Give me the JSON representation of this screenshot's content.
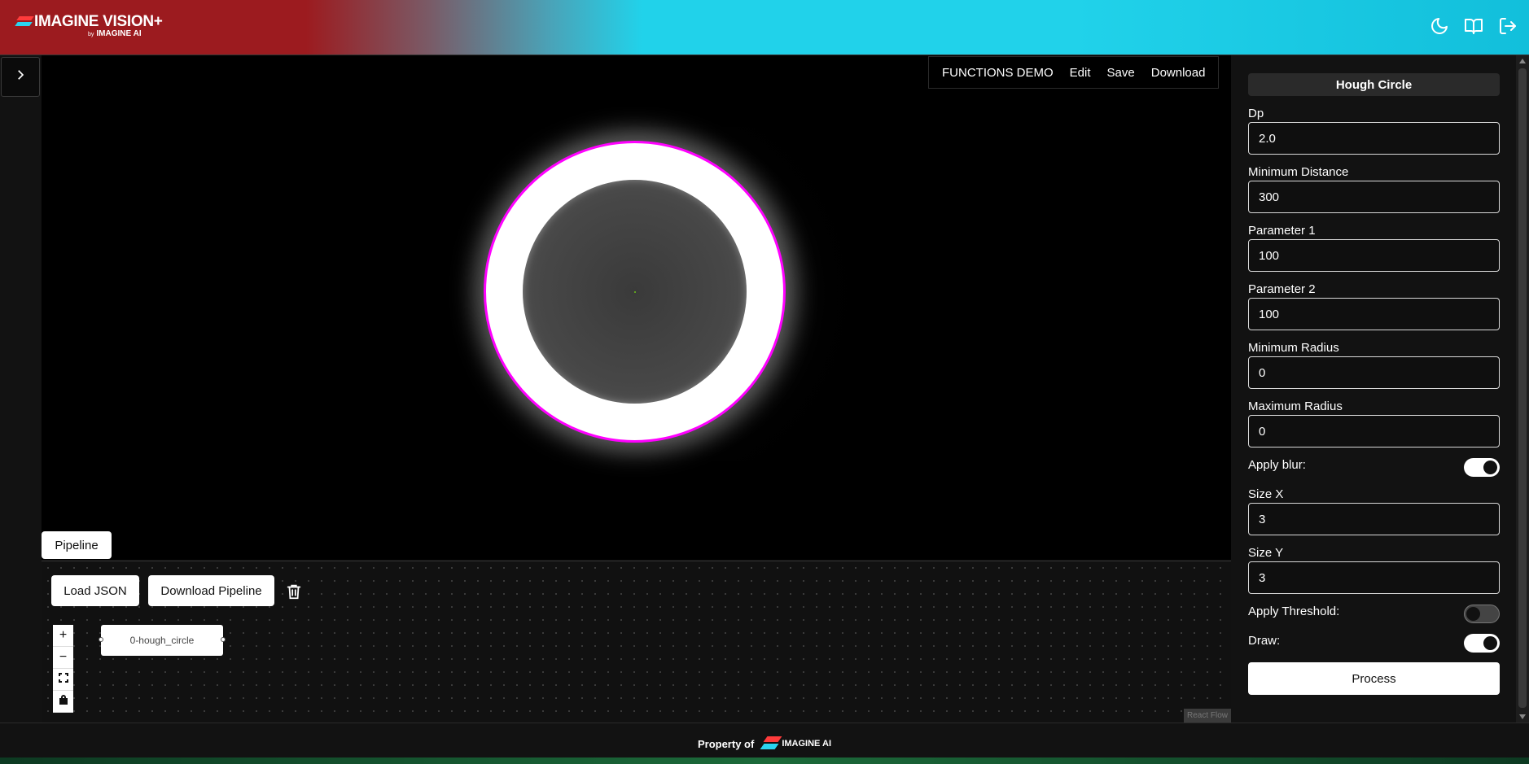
{
  "header": {
    "brand": "IMAGINE VISION+",
    "brand_by": "by",
    "brand_sub": "IMAGINE AI",
    "icons": [
      "moon-icon",
      "book-icon",
      "logout-icon"
    ]
  },
  "topmenu": {
    "items": [
      "FUNCTIONS DEMO",
      "Edit",
      "Save",
      "Download"
    ]
  },
  "canvas": {
    "detection_color": "#ff00ff"
  },
  "pipeline": {
    "tab_label": "Pipeline",
    "load_json": "Load JSON",
    "download_pipeline": "Download Pipeline",
    "node_label": "0-hough_circle",
    "zoom_in": "+",
    "zoom_out": "−",
    "attribution": "React Flow"
  },
  "panel": {
    "title": "Hough Circle",
    "fields": [
      {
        "label": "Dp",
        "value": "2.0"
      },
      {
        "label": "Minimum Distance",
        "value": "300"
      },
      {
        "label": "Parameter 1",
        "value": "100"
      },
      {
        "label": "Parameter 2",
        "value": "100"
      },
      {
        "label": "Minimum Radius",
        "value": "0"
      },
      {
        "label": "Maximum Radius",
        "value": "0"
      }
    ],
    "apply_blur_label": "Apply blur:",
    "apply_blur": true,
    "size_x_label": "Size X",
    "size_x": "3",
    "size_y_label": "Size Y",
    "size_y": "3",
    "apply_threshold_label": "Apply Threshold:",
    "apply_threshold": false,
    "draw_label": "Draw:",
    "draw": true,
    "process_label": "Process"
  },
  "footer": {
    "text": "Property of",
    "logo_text": "IMAGINE AI"
  }
}
